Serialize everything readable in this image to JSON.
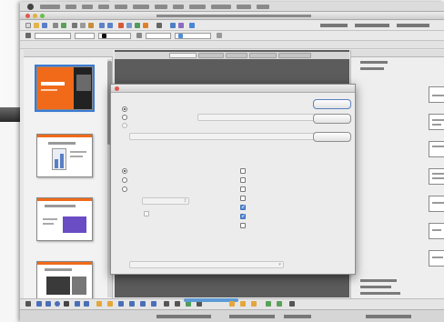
{
  "colors": {
    "accent_orange": "#f06a1a",
    "selection_blue": "#3a7bd5",
    "slide_purple": "#6a4cc4"
  },
  "dialog": {
    "title": "",
    "range_label": "",
    "range_options": [
      {
        "label": "",
        "selected": true
      },
      {
        "label": "",
        "selected": false
      },
      {
        "label": "",
        "selected": false
      }
    ],
    "range_select_value": "",
    "custom_show_value": "",
    "type_label": "",
    "type_options": [
      {
        "label": "",
        "selected": true
      },
      {
        "label": "",
        "selected": false
      },
      {
        "label": "",
        "selected": false
      }
    ],
    "pause_value": "",
    "show_logo_label": "",
    "options_label": "",
    "options": [
      {
        "label": "",
        "checked": false
      },
      {
        "label": "",
        "checked": false
      },
      {
        "label": "",
        "checked": false
      },
      {
        "label": "",
        "checked": false
      },
      {
        "label": "",
        "checked": true
      },
      {
        "label": "",
        "checked": true
      },
      {
        "label": "",
        "checked": false
      }
    ],
    "multiple_displays_label": "",
    "display_select_value": "",
    "buttons": {
      "ok": "",
      "cancel": "",
      "help": ""
    }
  },
  "slides_panel": {
    "title": "",
    "thumbnails": [
      {
        "caption": "",
        "number": ""
      },
      {
        "caption": "",
        "number": ""
      },
      {
        "caption": "",
        "number": ""
      },
      {
        "caption": "",
        "number": ""
      }
    ]
  },
  "tasks_panel": {
    "title": "",
    "section": ""
  },
  "view_tabs": [
    "",
    "",
    "",
    "",
    ""
  ],
  "icons": [
    "apple-icon",
    "close-icon",
    "minimize-icon",
    "zoom-icon",
    "radio-icon",
    "checkbox-icon",
    "dropdown-arrow-icon"
  ]
}
